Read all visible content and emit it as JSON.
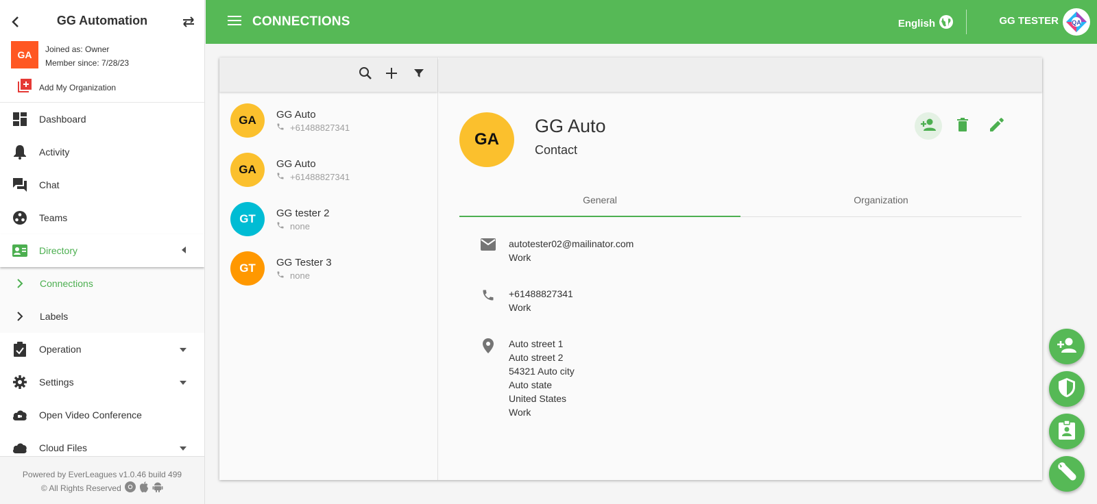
{
  "sidebar": {
    "org_name": "GG Automation",
    "avatar_initials": "GA",
    "joined_as": "Joined as: Owner",
    "member_since": "Member since: 7/28/23",
    "add_org_label": "Add My Organization",
    "items": [
      {
        "label": "Dashboard",
        "icon": "dashboard-icon"
      },
      {
        "label": "Activity",
        "icon": "bell-icon"
      },
      {
        "label": "Chat",
        "icon": "chat-icon"
      },
      {
        "label": "Teams",
        "icon": "teams-icon"
      },
      {
        "label": "Directory",
        "icon": "contact-card-icon"
      },
      {
        "label": "Connections",
        "icon": "chevron-right-icon"
      },
      {
        "label": "Labels",
        "icon": "chevron-right-icon"
      },
      {
        "label": "Operation",
        "icon": "clipboard-check-icon"
      },
      {
        "label": "Settings",
        "icon": "gear-icon"
      },
      {
        "label": "Open Video Conference",
        "icon": "cloud-video-icon"
      },
      {
        "label": "Cloud Files",
        "icon": "cloud-icon"
      }
    ],
    "footer_line1": "Powered by EverLeagues v1.0.46 build 499",
    "footer_line2": "© All Rights Reserved"
  },
  "topbar": {
    "title": "CONNECTIONS",
    "language": "English",
    "user": "GG TESTER",
    "accent": "#56b956"
  },
  "contacts": [
    {
      "initials": "GA",
      "name": "GG Auto",
      "phone": "+61488827341",
      "color": "#fbc02d",
      "text_color": "#111111"
    },
    {
      "initials": "GA",
      "name": "GG Auto",
      "phone": "+61488827341",
      "color": "#fbc02d",
      "text_color": "#111111"
    },
    {
      "initials": "GT",
      "name": "GG tester 2",
      "phone": "none",
      "color": "#00bcd4",
      "text_color": "#ffffff"
    },
    {
      "initials": "GT",
      "name": "GG Tester 3",
      "phone": "none",
      "color": "#ff9800",
      "text_color": "#ffffff"
    }
  ],
  "detail": {
    "initials": "GA",
    "name": "GG Auto",
    "type": "Contact",
    "tabs": [
      "General",
      "Organization"
    ],
    "email": "autotester02@mailinator.com",
    "email_type": "Work",
    "phone": "+61488827341",
    "phone_type": "Work",
    "address": [
      "Auto street 1",
      "Auto street 2",
      "54321 Auto city",
      "Auto state",
      "United States",
      "Work"
    ]
  }
}
